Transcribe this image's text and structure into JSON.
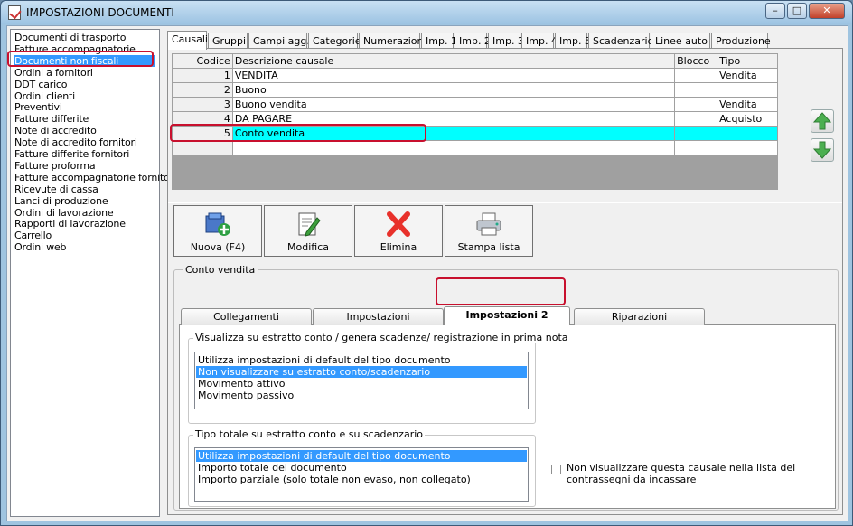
{
  "window": {
    "title": "IMPOSTAZIONI DOCUMENTI",
    "min": "–",
    "max": "□",
    "close": "✕"
  },
  "doc_types": [
    "Documenti di trasporto",
    "Fatture accompagnatorie",
    "Documenti non fiscali",
    "Ordini a fornitori",
    "DDT carico",
    "Ordini clienti",
    "Preventivi",
    "Fatture differite",
    "Note di accredito",
    "Note di accredito fornitori",
    "Fatture differite fornitori",
    "Fatture proforma",
    "Fatture accompagnatorie fornitori",
    "Ricevute di cassa",
    "Lanci di produzione",
    "Ordini di lavorazione",
    "Rapporti di lavorazione",
    "Carrello",
    "Ordini web"
  ],
  "selected_doc_index": 2,
  "tabs": [
    "Causali",
    "Gruppi",
    "Campi agg.",
    "Categorie",
    "Numerazioni",
    "Imp. 1",
    "Imp. 2",
    "Imp. 3",
    "Imp. 4",
    "Imp. 5",
    "Scadenzario",
    "Linee auto",
    "Produzione"
  ],
  "grid": {
    "columns": [
      "Codice",
      "Descrizione causale",
      "Blocco",
      "Tipo"
    ],
    "rows": [
      {
        "code": "1",
        "desc": "VENDITA",
        "blocco": "",
        "tipo": "Vendita"
      },
      {
        "code": "2",
        "desc": "Buono",
        "blocco": "",
        "tipo": ""
      },
      {
        "code": "3",
        "desc": "Buono vendita",
        "blocco": "",
        "tipo": "Vendita"
      },
      {
        "code": "4",
        "desc": "DA PAGARE",
        "blocco": "",
        "tipo": "Acquisto"
      },
      {
        "code": "5",
        "desc": "Conto vendita",
        "blocco": "",
        "tipo": ""
      }
    ],
    "selected_row": 4
  },
  "toolbar": {
    "new": "Nuova (F4)",
    "edit": "Modifica",
    "delete": "Elimina",
    "print": "Stampa lista"
  },
  "group_title": "Conto vendita",
  "inner_tabs": [
    "Collegamenti",
    "Impostazioni",
    "Impostazioni 2",
    "Riparazioni"
  ],
  "inner_tab_active": 2,
  "section1": {
    "title": "Visualizza su estratto conto / genera scadenze/ registrazione  in prima nota",
    "options": [
      "Utilizza impostazioni di default del tipo documento",
      "Non visualizzare su estratto conto/scadenzario",
      "Movimento attivo",
      "Movimento passivo"
    ],
    "selected": 1
  },
  "section2": {
    "title": "Tipo totale su estratto conto e su scadenzario",
    "options": [
      "Utilizza impostazioni di default del tipo documento",
      "Importo totale del documento",
      "Importo parziale (solo totale non evaso, non collegato)"
    ],
    "selected": 0
  },
  "checkbox": {
    "label": "Non visualizzare questa causale nella lista dei contrassegni da incassare",
    "checked": false
  },
  "colors": {
    "selection": "#3399ff",
    "row_highlight": "#00ffff",
    "annotation": "#c8102e"
  }
}
